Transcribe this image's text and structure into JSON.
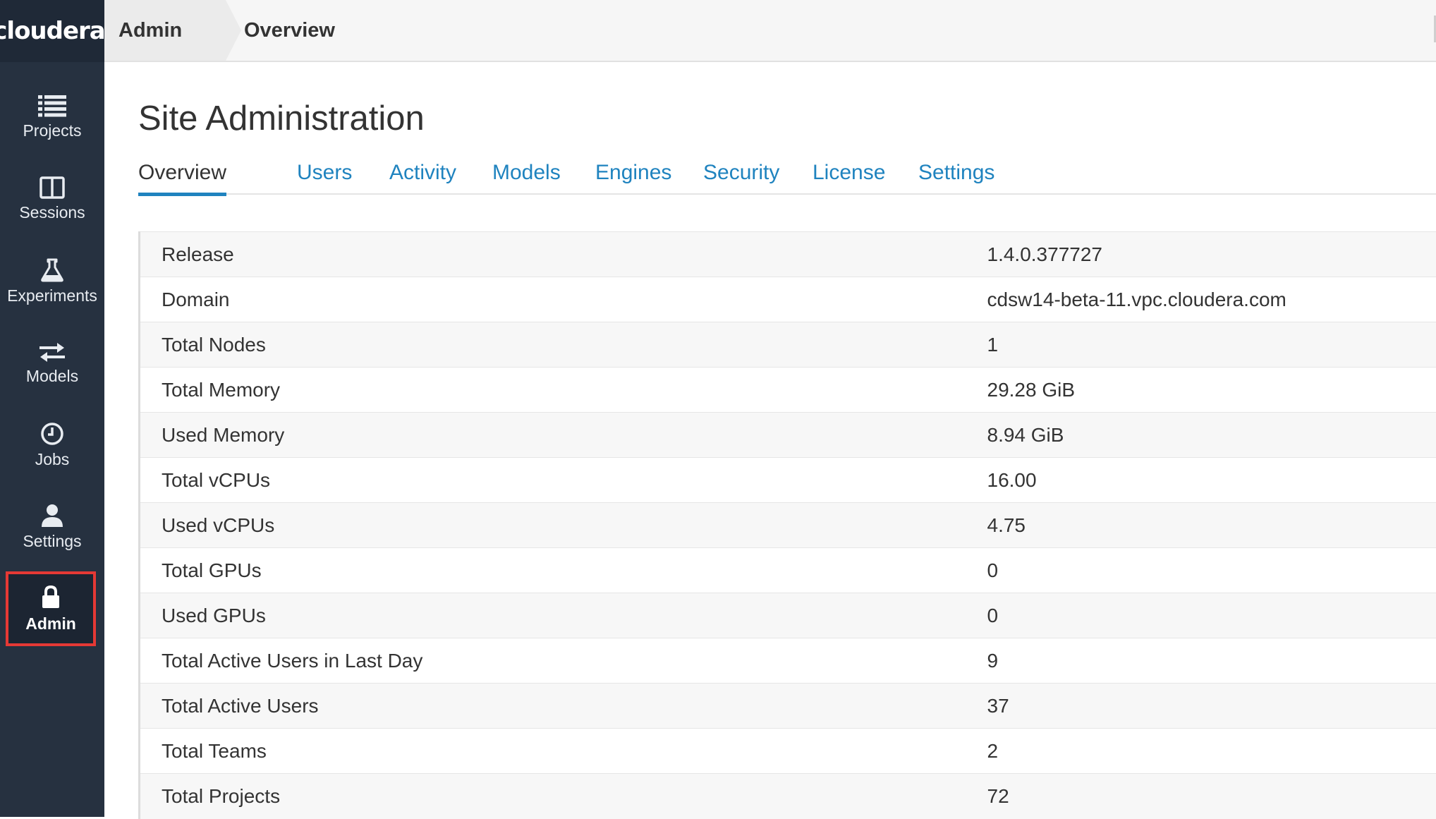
{
  "brand": {
    "logo_text": "cloudera",
    "logo_mark": "®"
  },
  "sidebar": {
    "items": [
      {
        "label": "Projects",
        "icon": "list-icon"
      },
      {
        "label": "Sessions",
        "icon": "columns-icon"
      },
      {
        "label": "Experiments",
        "icon": "flask-icon"
      },
      {
        "label": "Models",
        "icon": "arrows-exchange-icon"
      },
      {
        "label": "Jobs",
        "icon": "clock-icon"
      },
      {
        "label": "Settings",
        "icon": "user-icon"
      },
      {
        "label": "Admin",
        "icon": "lock-icon",
        "active": true
      }
    ]
  },
  "breadcrumb": {
    "parent": "Admin",
    "current": "Overview"
  },
  "page": {
    "title": "Site Administration"
  },
  "tabs": [
    {
      "label": "Overview",
      "active": true
    },
    {
      "label": "Users"
    },
    {
      "label": "Activity"
    },
    {
      "label": "Models"
    },
    {
      "label": "Engines"
    },
    {
      "label": "Security"
    },
    {
      "label": "License"
    },
    {
      "label": "Settings"
    }
  ],
  "overview": {
    "rows": [
      {
        "key": "Release",
        "value": "1.4.0.377727"
      },
      {
        "key": "Domain",
        "value": "cdsw14-beta-11.vpc.cloudera.com"
      },
      {
        "key": "Total Nodes",
        "value": "1"
      },
      {
        "key": "Total Memory",
        "value": "29.28 GiB"
      },
      {
        "key": "Used Memory",
        "value": "8.94 GiB"
      },
      {
        "key": "Total vCPUs",
        "value": "16.00"
      },
      {
        "key": "Used vCPUs",
        "value": "4.75"
      },
      {
        "key": "Total GPUs",
        "value": "0"
      },
      {
        "key": "Used GPUs",
        "value": "0"
      },
      {
        "key": "Total Active Users in Last Day",
        "value": "9"
      },
      {
        "key": "Total Active Users",
        "value": "37"
      },
      {
        "key": "Total Teams",
        "value": "2"
      },
      {
        "key": "Total Projects",
        "value": "72"
      }
    ]
  },
  "colors": {
    "sidebar_bg": "#263140",
    "accent_link": "#1f83bf",
    "highlight_border": "#e53935"
  }
}
